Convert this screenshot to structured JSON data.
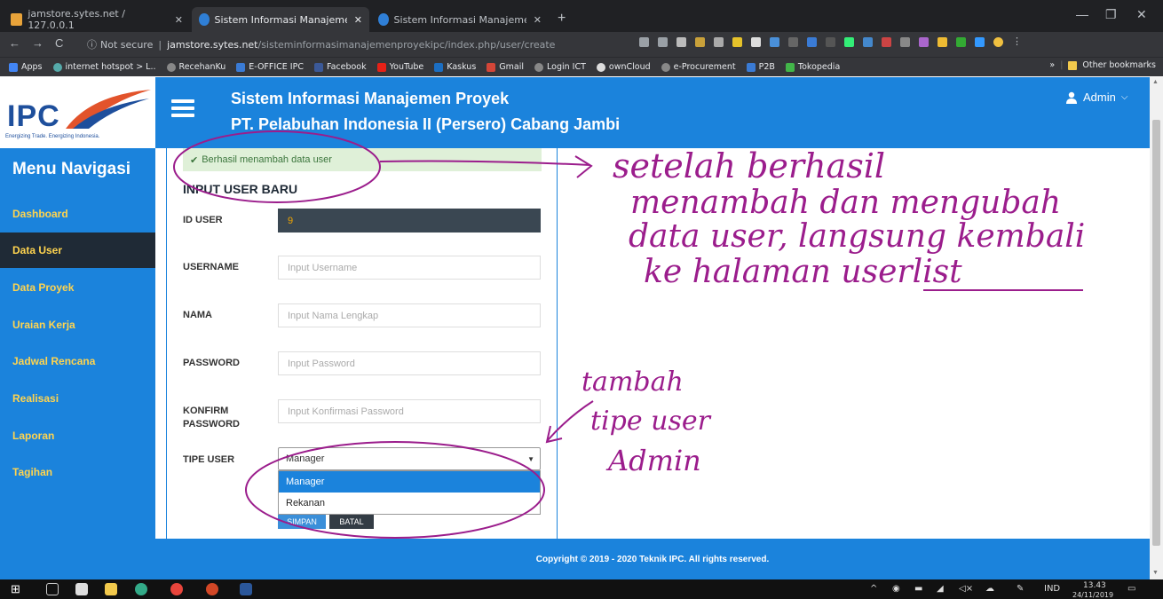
{
  "browser": {
    "tabs": [
      {
        "label": "jamstore.sytes.net / 127.0.0.1",
        "icon": "phpmyadmin-icon"
      },
      {
        "label": "Sistem Informasi Manajemen Pro",
        "icon": "edge-icon"
      },
      {
        "label": "Sistem Informasi Manajemen Pro",
        "icon": "edge-icon"
      }
    ],
    "new_tab": "+",
    "security": "Not secure",
    "url_host": "jamstore.sytes.net",
    "url_path": "/sisteminformasimanajemenproyekipc/index.php/user/create",
    "bookmarks": [
      "Apps",
      "internet hotspot > L..",
      "RecehanKu",
      "E-OFFICE IPC",
      "Facebook",
      "YouTube",
      "Kaskus",
      "Gmail",
      "Login ICT",
      "ownCloud",
      "e-Procurement",
      "P2B",
      "Tokopedia"
    ],
    "other_bookmarks": "Other bookmarks",
    "more_bookmarks": "»"
  },
  "app": {
    "logo_text": "IPC",
    "logo_tagline": "Energizing Trade. Energizing Indonesia.",
    "title_line1": "Sistem Informasi Manajemen Proyek",
    "title_line2": "PT. Pelabuhan Indonesia II (Persero) Cabang Jambi",
    "user_label": "Admin"
  },
  "sidebar": {
    "title": "Menu Navigasi",
    "items": [
      {
        "label": "Dashboard"
      },
      {
        "label": "Data User"
      },
      {
        "label": "Data Proyek"
      },
      {
        "label": "Uraian Kerja"
      },
      {
        "label": "Jadwal Rencana"
      },
      {
        "label": "Realisasi"
      },
      {
        "label": "Laporan"
      },
      {
        "label": "Tagihan"
      }
    ]
  },
  "form": {
    "alert": "Berhasil menambah data user",
    "title": "INPUT USER BARU",
    "id_label": "ID USER",
    "id_value": "9",
    "username_label": "USERNAME",
    "username_placeholder": "Input Username",
    "nama_label": "NAMA",
    "nama_placeholder": "Input Nama Lengkap",
    "password_label": "PASSWORD",
    "password_placeholder": "Input Password",
    "konfirm_label_1": "KONFIRM",
    "konfirm_label_2": "PASSWORD",
    "konfirm_placeholder": "Input Konfirmasi Password",
    "tipe_label": "TIPE USER",
    "tipe_selected": "Manager",
    "tipe_options": [
      "Manager",
      "Rekanan"
    ],
    "save_label": "SIMPAN",
    "cancel_label": "BATAL"
  },
  "footer": {
    "copyright": "Copyright © 2019 - 2020 Teknik IPC. All rights reserved."
  },
  "taskbar": {
    "lang": "IND",
    "time": "13.43",
    "date": "24/11/2019"
  },
  "annotations": {
    "note1_line1": "setelah berhasil",
    "note1_line2": "menambah dan mengubah",
    "note1_line3": "data user, langsung kembali",
    "note1_line4": "ke halaman userlist",
    "note2_line1": "tambah",
    "note2_line2": "tipe user",
    "note2_line3": "Admin"
  },
  "colors": {
    "primary": "#1b83dc",
    "sidebar_text": "#ffd44f",
    "annotation": "#9b1d8c"
  }
}
